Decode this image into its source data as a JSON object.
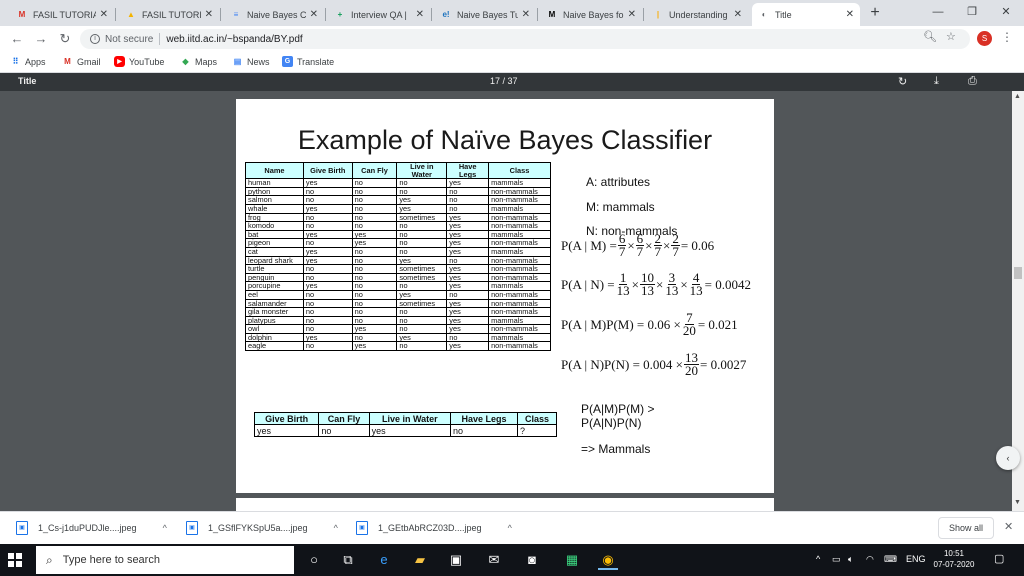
{
  "tabs": [
    {
      "title": "FASIL TUTORIAL",
      "icon": "gmail-icon",
      "fav_text": "M",
      "fav_color": "#d93025"
    },
    {
      "title": "FASIL TUTORIAL",
      "icon": "drive-icon",
      "fav_text": "▲",
      "fav_color": "#f4b400"
    },
    {
      "title": "Naive Bayes Cl",
      "icon": "docs-icon",
      "fav_text": "≡",
      "fav_color": "#4285f4"
    },
    {
      "title": "Interview QA |",
      "icon": "sheets-icon",
      "fav_text": "+",
      "fav_color": "#0f9d58"
    },
    {
      "title": "Naive Bayes Tu",
      "icon": "ie-icon",
      "fav_text": "e!",
      "fav_color": "#1e73be"
    },
    {
      "title": "Naive Bayes fo",
      "icon": "medium-icon",
      "fav_text": "M",
      "fav_color": "#000000"
    },
    {
      "title": "Understanding",
      "icon": "bookmark-icon",
      "fav_text": "|",
      "fav_color": "#f9ab00"
    },
    {
      "title": "Title",
      "icon": "globe-icon",
      "fav_text": "◐",
      "fav_color": "#5f6368"
    }
  ],
  "address": {
    "security": "Not secure",
    "url": "web.iitd.ac.in/~bspanda/BY.pdf"
  },
  "profile_initial": "S",
  "bookmarks": [
    {
      "label": "Apps",
      "icon": "apps-grid-icon"
    },
    {
      "label": "Gmail",
      "icon": "gmail-icon"
    },
    {
      "label": "YouTube",
      "icon": "youtube-icon"
    },
    {
      "label": "Maps",
      "icon": "maps-icon"
    },
    {
      "label": "News",
      "icon": "news-icon"
    },
    {
      "label": "Translate",
      "icon": "translate-icon"
    }
  ],
  "pdf": {
    "title": "Title",
    "page_indicator": "17 / 37"
  },
  "slide": {
    "title": "Example of Naïve Bayes Classifier",
    "train_headers": [
      "Name",
      "Give Birth",
      "Can Fly",
      "Live in Water",
      "Have Legs",
      "Class"
    ],
    "train_rows": [
      [
        "human",
        "yes",
        "no",
        "no",
        "yes",
        "mammals"
      ],
      [
        "python",
        "no",
        "no",
        "no",
        "no",
        "non-mammals"
      ],
      [
        "salmon",
        "no",
        "no",
        "yes",
        "no",
        "non-mammals"
      ],
      [
        "whale",
        "yes",
        "no",
        "yes",
        "no",
        "mammals"
      ],
      [
        "frog",
        "no",
        "no",
        "sometimes",
        "yes",
        "non-mammals"
      ],
      [
        "komodo",
        "no",
        "no",
        "no",
        "yes",
        "non-mammals"
      ],
      [
        "bat",
        "yes",
        "yes",
        "no",
        "yes",
        "mammals"
      ],
      [
        "pigeon",
        "no",
        "yes",
        "no",
        "yes",
        "non-mammals"
      ],
      [
        "cat",
        "yes",
        "no",
        "no",
        "yes",
        "mammals"
      ],
      [
        "leopard shark",
        "yes",
        "no",
        "yes",
        "no",
        "non-mammals"
      ],
      [
        "turtle",
        "no",
        "no",
        "sometimes",
        "yes",
        "non-mammals"
      ],
      [
        "penguin",
        "no",
        "no",
        "sometimes",
        "yes",
        "non-mammals"
      ],
      [
        "porcupine",
        "yes",
        "no",
        "no",
        "yes",
        "mammals"
      ],
      [
        "eel",
        "no",
        "no",
        "yes",
        "no",
        "non-mammals"
      ],
      [
        "salamander",
        "no",
        "no",
        "sometimes",
        "yes",
        "non-mammals"
      ],
      [
        "gila monster",
        "no",
        "no",
        "no",
        "yes",
        "non-mammals"
      ],
      [
        "platypus",
        "no",
        "no",
        "no",
        "yes",
        "mammals"
      ],
      [
        "owl",
        "no",
        "yes",
        "no",
        "yes",
        "non-mammals"
      ],
      [
        "dolphin",
        "yes",
        "no",
        "yes",
        "no",
        "mammals"
      ],
      [
        "eagle",
        "no",
        "yes",
        "no",
        "yes",
        "non-mammals"
      ]
    ],
    "test_headers": [
      "Give Birth",
      "Can Fly",
      "Live in Water",
      "Have Legs",
      "Class"
    ],
    "test_row": [
      "yes",
      "no",
      "yes",
      "no",
      "?"
    ],
    "legend": [
      "A: attributes",
      "M: mammals",
      "N: non-mammals"
    ],
    "f1": {
      "lhs": "P(A | M) =",
      "fracs": [
        [
          "6",
          "7"
        ],
        [
          "6",
          "7"
        ],
        [
          "2",
          "7"
        ],
        [
          "2",
          "7"
        ]
      ],
      "times": "×",
      "rhs": "= 0.06"
    },
    "f2": {
      "lhs": "P(A | N) =",
      "fracs": [
        [
          "1",
          "13"
        ],
        [
          "10",
          "13"
        ],
        [
          "3",
          "13"
        ],
        [
          "4",
          "13"
        ]
      ],
      "times": "×",
      "rhs": "= 0.0042"
    },
    "f3": {
      "lhs": "P(A | M)P(M) = 0.06 ×",
      "frac": [
        "7",
        "20"
      ],
      "rhs": "= 0.021"
    },
    "f4": {
      "lhs": "P(A | N)P(N) = 0.004 ×",
      "frac": [
        "13",
        "20"
      ],
      "rhs": "= 0.0027"
    },
    "conclusion": [
      "P(A|M)P(M) >",
      "P(A|N)P(N)",
      "=> Mammals"
    ]
  },
  "downloads": [
    {
      "name": "1_Cs-j1duPUDJle....jpeg"
    },
    {
      "name": "1_GSflFYKSpU5a....jpeg"
    },
    {
      "name": "1_GEtbAbRCZ03D....jpeg"
    }
  ],
  "show_all": "Show all",
  "taskbar": {
    "search_placeholder": "Type here to search",
    "lang": "ENG",
    "time": "10:51",
    "date": "07-07-2020"
  }
}
